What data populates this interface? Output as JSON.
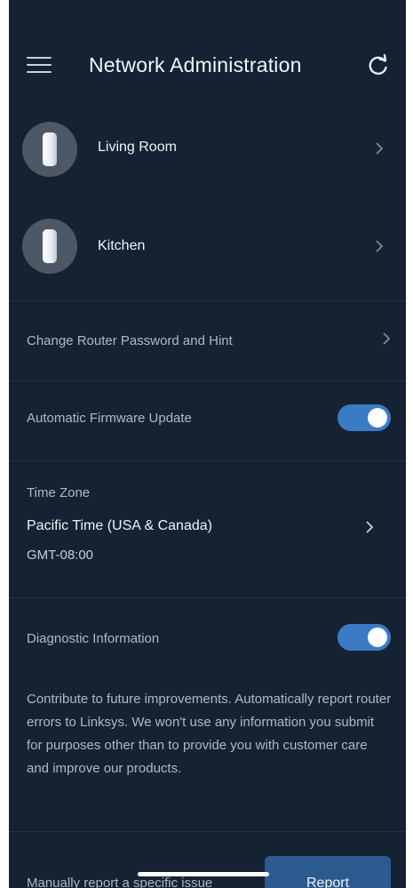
{
  "header": {
    "title": "Network Administration"
  },
  "nodes": [
    {
      "label": "Living Room"
    },
    {
      "label": "Kitchen"
    }
  ],
  "password": {
    "label": "Change Router Password and Hint"
  },
  "firmware": {
    "label": "Automatic Firmware Update",
    "enabled": true
  },
  "time_zone": {
    "label": "Time Zone",
    "value": "Pacific Time (USA & Canada)",
    "offset": "GMT-08:00"
  },
  "diagnostic": {
    "label": "Diagnostic Information",
    "enabled": true,
    "description": "Contribute to future improvements. Automatically report router errors to Linksys. We won't use any information you submit for purposes other than to provide you with customer care and improve our products."
  },
  "manual_report": {
    "label": "Manually report a specific issue",
    "button_label": "Report"
  },
  "colors": {
    "background": "#142234",
    "toggle_on": "#3b7bc4",
    "button": "#2b5a8f"
  },
  "icons": {
    "menu": "hamburger-menu-icon",
    "refresh": "refresh-icon",
    "chevron": "chevron-right-icon",
    "node": "velop-node-icon"
  }
}
